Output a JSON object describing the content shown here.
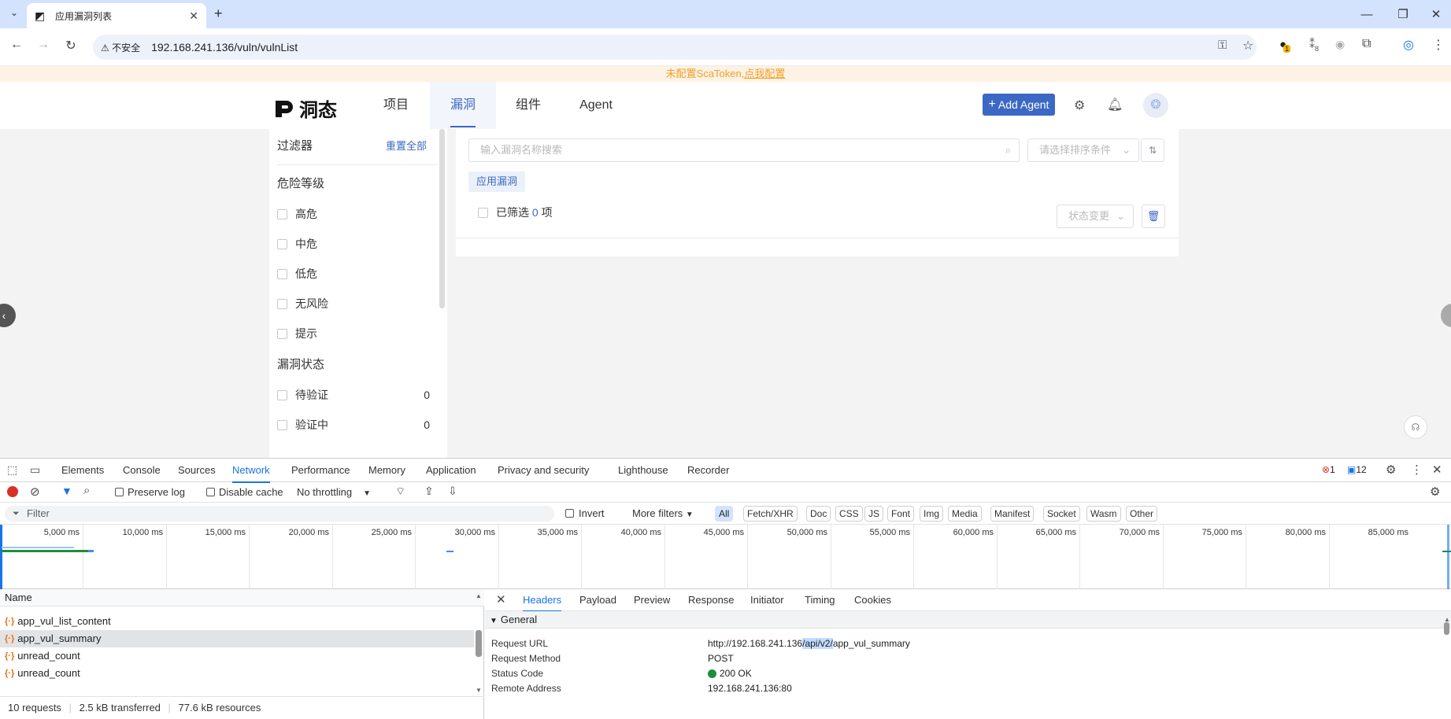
{
  "browser": {
    "tab_title": "应用漏洞列表",
    "new_tab": "+",
    "security_label": "不安全",
    "url": "192.168.241.136/vuln/vulnList",
    "ext_badge_1": "1",
    "ext_badge_2": "8"
  },
  "banner": {
    "prefix": "未配置ScaToken",
    "link": ",点我配置"
  },
  "header": {
    "logo_text": "洞态",
    "nav": [
      "项目",
      "漏洞",
      "组件",
      "Agent"
    ],
    "active_nav": "漏洞",
    "add_agent": "Add Agent"
  },
  "filter": {
    "title": "过滤器",
    "reset": "重置全部",
    "severity_title": "危险等级",
    "severity_items": [
      "高危",
      "中危",
      "低危",
      "无风险",
      "提示"
    ],
    "status_title": "漏洞状态",
    "status_items": [
      {
        "label": "待验证",
        "count": "0"
      },
      {
        "label": "验证中",
        "count": "0"
      }
    ]
  },
  "main": {
    "search_placeholder": "输入漏洞名称搜索",
    "sort_placeholder": "请选择排序条件",
    "app_tag": "应用漏洞",
    "selected_prefix": "已筛选",
    "selected_count": "0",
    "selected_suffix": "项",
    "status_change": "状态变更"
  },
  "devtools": {
    "tabs": [
      "Elements",
      "Console",
      "Sources",
      "Network",
      "Performance",
      "Memory",
      "Application",
      "Privacy and security",
      "Lighthouse",
      "Recorder"
    ],
    "active_tab": "Network",
    "error_count": "1",
    "message_count": "12",
    "toolbar": {
      "preserve_log": "Preserve log",
      "disable_cache": "Disable cache",
      "throttling": "No throttling"
    },
    "filter": {
      "placeholder": "Filter",
      "invert": "Invert",
      "more_filters": "More filters",
      "types": [
        "All",
        "Fetch/XHR",
        "Doc",
        "CSS",
        "JS",
        "Font",
        "Img",
        "Media",
        "Manifest",
        "Socket",
        "Wasm",
        "Other"
      ]
    },
    "timeline_ticks": [
      "5,000 ms",
      "10,000 ms",
      "15,000 ms",
      "20,000 ms",
      "25,000 ms",
      "30,000 ms",
      "35,000 ms",
      "40,000 ms",
      "45,000 ms",
      "50,000 ms",
      "55,000 ms",
      "60,000 ms",
      "65,000 ms",
      "70,000 ms",
      "75,000 ms",
      "80,000 ms",
      "85,000 ms"
    ],
    "requests": {
      "header": "Name",
      "items": [
        "app_vul_list_content",
        "app_vul_summary",
        "unread_count",
        "unread_count"
      ],
      "selected": "app_vul_summary",
      "summary_requests": "10 requests",
      "summary_transferred": "2.5 kB transferred",
      "summary_resources": "77.6 kB resources"
    },
    "detail": {
      "tabs": [
        "Headers",
        "Payload",
        "Preview",
        "Response",
        "Initiator",
        "Timing",
        "Cookies"
      ],
      "active_tab": "Headers",
      "section": "General",
      "rows": [
        {
          "key": "Request URL",
          "value_a": "http://192.168.241.136",
          "value_hl": "/api/v2/",
          "value_b": "app_vul_summary"
        },
        {
          "key": "Request Method",
          "value": "POST"
        },
        {
          "key": "Status Code",
          "value": "200 OK"
        },
        {
          "key": "Remote Address",
          "value": "192.168.241.136:80"
        }
      ]
    }
  }
}
